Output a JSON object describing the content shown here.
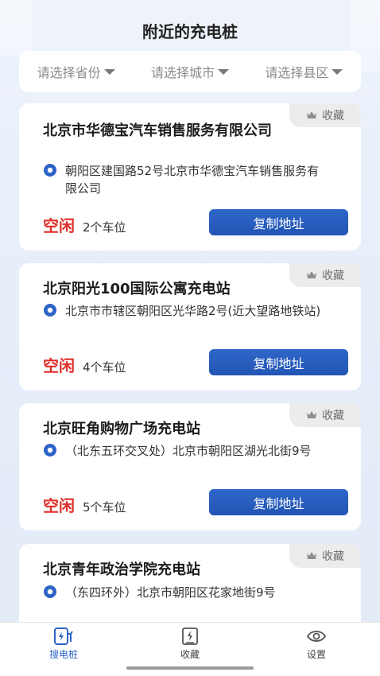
{
  "page": {
    "title": "附近的充电桩"
  },
  "filters": [
    {
      "label": "请选择省份"
    },
    {
      "label": "请选择城市"
    },
    {
      "label": "请选择县区"
    }
  ],
  "fav_label": "收藏",
  "copy_label": "复制地址",
  "stations": [
    {
      "name": "北京市华德宝汽车销售服务有限公司",
      "address": "朝阳区建国路52号北京市华德宝汽车销售服务有限公司",
      "status": "空闲",
      "spots": "2个车位"
    },
    {
      "name": "北京阳光100国际公寓充电站",
      "address": "北京市市辖区朝阳区光华路2号(近大望路地铁站)",
      "status": "空闲",
      "spots": "4个车位"
    },
    {
      "name": "北京旺角购物广场充电站",
      "address": "（北东五环交叉处）北京市朝阳区湖光北街9号",
      "status": "空闲",
      "spots": "5个车位"
    },
    {
      "name": "北京青年政治学院充电站",
      "address": "（东四环外）北京市朝阳区花家地街9号",
      "status": "",
      "spots": ""
    }
  ],
  "tabbar": {
    "items": [
      {
        "label": "搜电桩",
        "icon": "charger-icon"
      },
      {
        "label": "收藏",
        "icon": "favorite-icon"
      },
      {
        "label": "设置",
        "icon": "eye-icon"
      }
    ]
  },
  "colors": {
    "accent": "#2d63c5",
    "status": "#e0302a",
    "button": "#2458b8"
  }
}
